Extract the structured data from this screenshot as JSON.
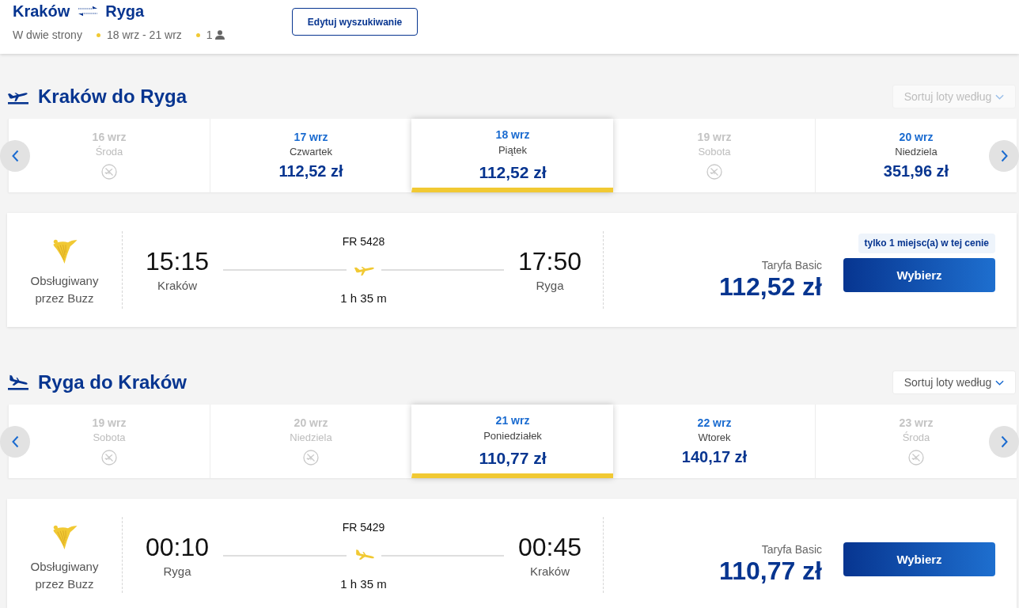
{
  "header": {
    "origin": "Kraków",
    "destination": "Ryga",
    "trip_type": "W dwie strony",
    "dates": "18 wrz - 21 wrz",
    "passengers": "1",
    "edit_button": "Edytuj wyszukiwanie"
  },
  "journeys": [
    {
      "kind": "outbound",
      "title": "Kraków do Ryga",
      "sort": {
        "label": "Sortuj loty według",
        "disabled": true
      },
      "dates": [
        {
          "date": "16 wrz",
          "day": "Środa",
          "available": false,
          "selected": false
        },
        {
          "date": "17 wrz",
          "day": "Czwartek",
          "price": "112,52 zł",
          "available": true,
          "selected": false
        },
        {
          "date": "18 wrz",
          "day": "Piątek",
          "price": "112,52 zł",
          "available": true,
          "selected": true
        },
        {
          "date": "19 wrz",
          "day": "Sobota",
          "available": false,
          "selected": false
        },
        {
          "date": "20 wrz",
          "day": "Niedziela",
          "price": "351,96 zł",
          "available": true,
          "selected": false
        }
      ],
      "flights": [
        {
          "operator": "Obsługiwany przez Buzz",
          "departure_time": "15:15",
          "departure_city": "Kraków",
          "flight_number": "FR 5428",
          "duration": "1 h 35 m",
          "arrival_time": "17:50",
          "arrival_city": "Ryga",
          "fare": "Taryfa Basic",
          "price": "112,52 zł",
          "badge": "tylko 1 miejsc(a) w tej cenie",
          "button": "Wybierz"
        }
      ]
    },
    {
      "kind": "inbound",
      "title": "Ryga do Kraków",
      "sort": {
        "label": "Sortuj loty według",
        "disabled": false
      },
      "dates": [
        {
          "date": "19 wrz",
          "day": "Sobota",
          "available": false,
          "selected": false
        },
        {
          "date": "20 wrz",
          "day": "Niedziela",
          "available": false,
          "selected": false
        },
        {
          "date": "21 wrz",
          "day": "Poniedziałek",
          "price": "110,77 zł",
          "available": true,
          "selected": true
        },
        {
          "date": "22 wrz",
          "day": "Wtorek",
          "price": "140,17 zł",
          "available": true,
          "selected": false
        },
        {
          "date": "23 wrz",
          "day": "Środa",
          "available": false,
          "selected": false
        }
      ],
      "flights": [
        {
          "operator": "Obsługiwany przez Buzz",
          "departure_time": "00:10",
          "departure_city": "Ryga",
          "flight_number": "FR 5429",
          "duration": "1 h 35 m",
          "arrival_time": "00:45",
          "arrival_city": "Kraków",
          "fare": "Taryfa Basic",
          "price": "110,77 zł",
          "button": "Wybierz"
        }
      ]
    }
  ]
}
